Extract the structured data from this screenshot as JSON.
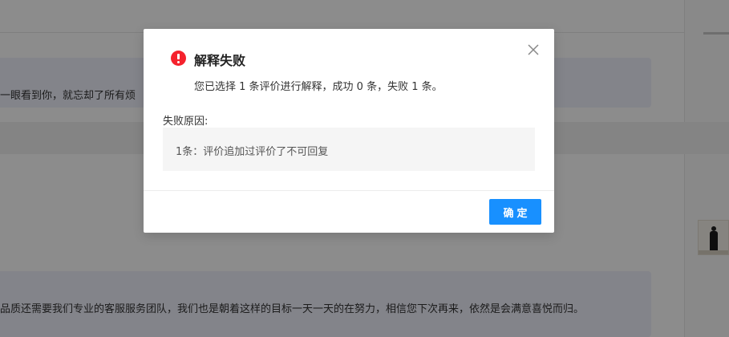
{
  "background": {
    "review_1_text": "一眼看到你，就忘却了所有烦",
    "review_2_text": "品质还需要我们专业的客服服务团队，我们也是朝着这样的目标一天一天的在努力，相信您下次再来，依然是会满意喜悦而归。"
  },
  "dialog": {
    "title": "解释失败",
    "message": "您已选择 1 条评价进行解释，成功 0 条，失败 1 条。",
    "reason_label": "失败原因:",
    "reasons": [
      "1条：评价追加过评价了不可回复"
    ],
    "ok_label": "确定"
  },
  "icons": {
    "status": "error-circle-icon",
    "close": "close-icon"
  },
  "colors": {
    "primary": "#1890ff",
    "error": "#f5222d",
    "mask": "rgba(0,0,0,0.45)"
  }
}
